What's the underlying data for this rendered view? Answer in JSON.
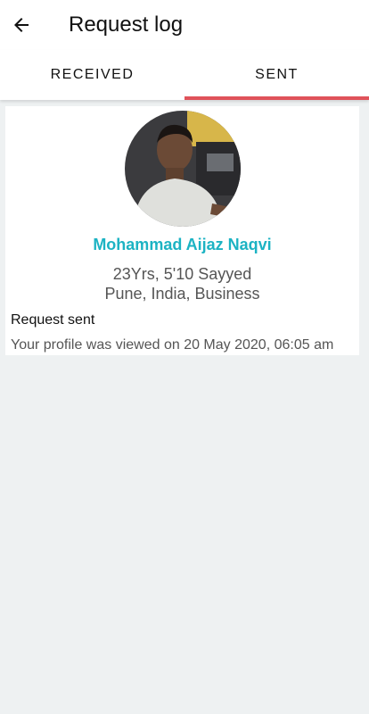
{
  "header": {
    "title": "Request log",
    "back_icon": "arrow-back-icon"
  },
  "tabs": [
    {
      "label": "RECEIVED",
      "active": false
    },
    {
      "label": "SENT",
      "active": true
    }
  ],
  "colors": {
    "accent": "#e0525a",
    "name": "#1cb3c3"
  },
  "card": {
    "name": "Mohammad Aijaz Naqvi",
    "line1": "23Yrs, 5'10 Sayyed",
    "line2": "Pune, India, Business",
    "status": "Request sent",
    "viewed": "Your profile was viewed on 20 May 2020, 06:05 am"
  }
}
